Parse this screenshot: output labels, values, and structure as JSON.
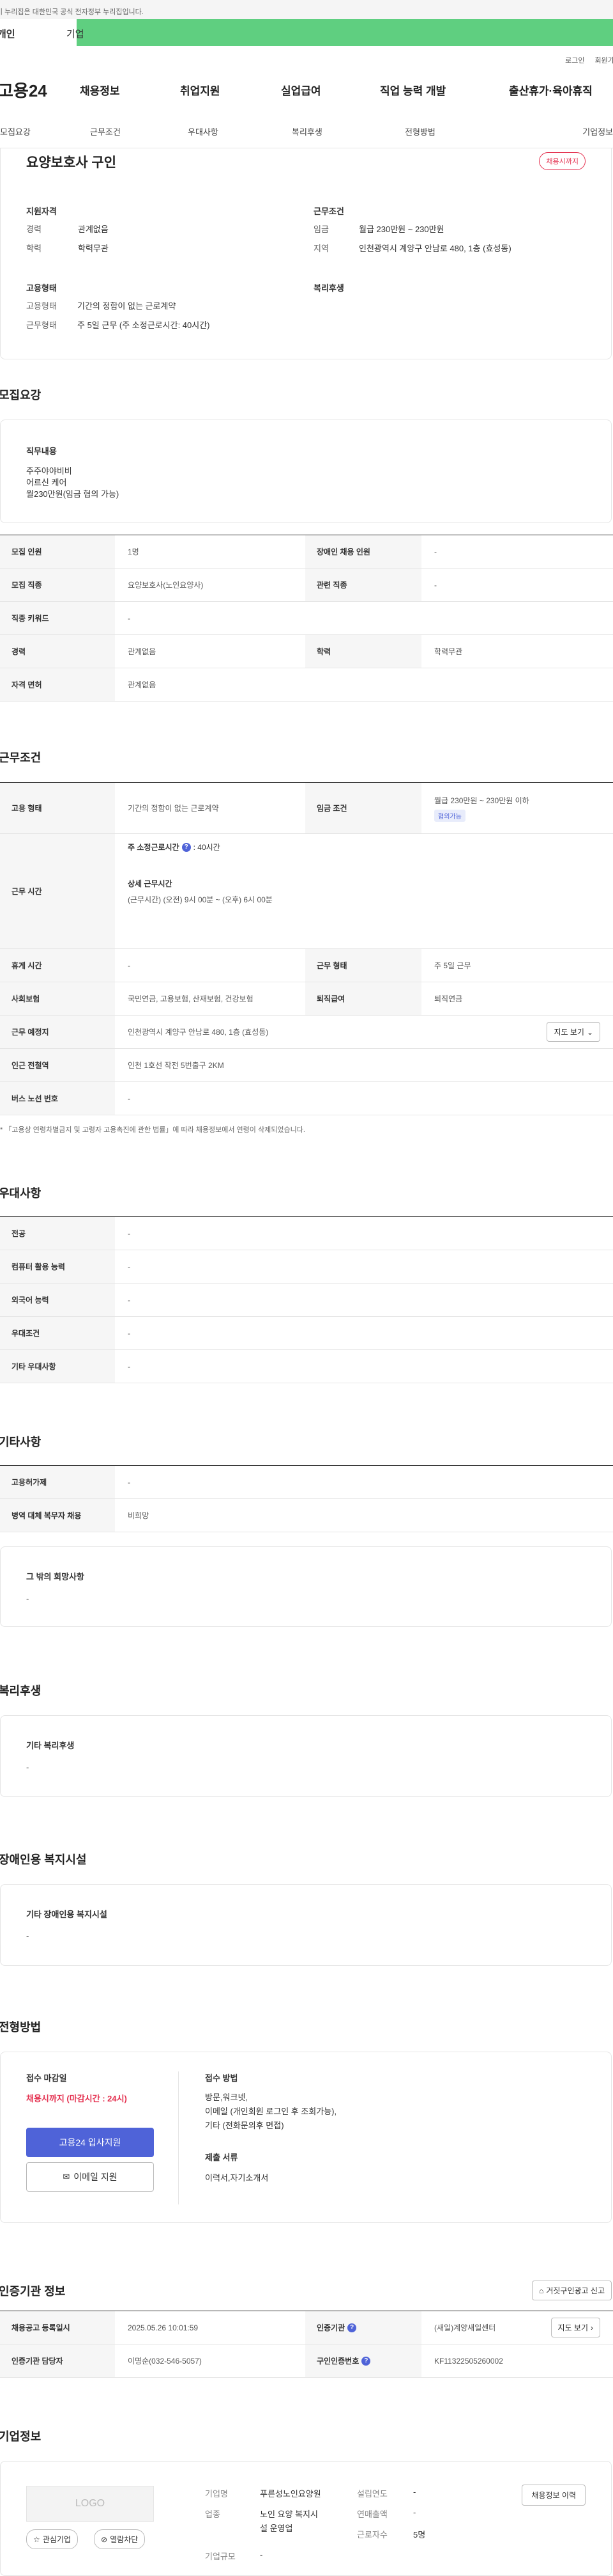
{
  "banner": {
    "text": "이 누리집은 대한민국 공식 전자정부 누리집입니다."
  },
  "top_tabs": {
    "individual": "개인",
    "business": "기업"
  },
  "utility": {
    "login": "로그인",
    "join": "회원가입"
  },
  "gnb": {
    "logo": "고용24",
    "items": [
      "채용정보",
      "취업지원",
      "실업급여",
      "직업 능력 개발",
      "출산휴가·육아휴직"
    ]
  },
  "lnb": {
    "items": [
      "모집요강",
      "근무조건",
      "우대사항",
      "복리후생",
      "전형방법",
      "기업정보"
    ]
  },
  "summary": {
    "title": "요양보호사 구인",
    "status_badge": "채용시까지",
    "qual": {
      "heading": "지원자격",
      "exp_k": "경력",
      "exp_v": "관계없음",
      "edu_k": "학력",
      "edu_v": "학력무관"
    },
    "cond": {
      "heading": "근무조건",
      "wage_k": "임금",
      "wage_v": "월급 230만원 ~ 230만원",
      "area_k": "지역",
      "area_v": "인천광역시 계양구 안남로 480, 1층 (효성동)"
    },
    "emp": {
      "heading": "고용형태",
      "type_k": "고용형태",
      "type_v": "기간의 정함이 없는 근로계약",
      "work_k": "근무형태",
      "work_v": "주 5일 근무 (주 소정근로시간: 40시간)"
    },
    "welfare": {
      "heading": "복리후생"
    }
  },
  "recruit": {
    "heading": "모집요강",
    "duty_heading": "직무내용",
    "duty_lines": [
      "주주야야비비",
      "어르신 케어",
      "월230만원(임금 협의 가능)"
    ],
    "rows": {
      "count_k": "모집 인원",
      "count_v": "1명",
      "disabled_k": "장애인 채용 인원",
      "disabled_v": "-",
      "job_k": "모집 직종",
      "job_v": "요양보호사(노인요양사)",
      "related_k": "관련 직종",
      "related_v": "-",
      "keyword_k": "직종 키워드",
      "keyword_v": "-",
      "career_k": "경력",
      "career_v": "관계없음",
      "edu_k": "학력",
      "edu_v": "학력무관",
      "license_k": "자격 면허",
      "license_v": "관계없음"
    }
  },
  "work": {
    "heading": "근무조건",
    "type_k": "고용 형태",
    "type_v": "기간의 정함이 없는 근로계약",
    "wage_k": "임금 조건",
    "wage_v": "월급 230만원 ~ 230만원 이하",
    "wage_badge": "협의가능",
    "hours_k": "근무 시간",
    "hours_weekly": "주 소정근로시간",
    "hours_weekly_v": ": 40시간",
    "hours_detail_h": "상세 근무시간",
    "hours_detail_v": "(근무시간) (오전) 9시 00분 ~ (오후) 6시 00분",
    "rest_k": "휴게 시간",
    "rest_v": "-",
    "shape_k": "근무 형태",
    "shape_v": "주 5일 근무",
    "ins_k": "사회보험",
    "ins_v": "국민연금, 고용보험, 산재보험, 건강보험",
    "retire_k": "퇴직급여",
    "retire_v": "퇴직연금",
    "place_k": "근무 예정지",
    "place_v": "인천광역시 계양구 안남로 480, 1층 (효성동)",
    "map_btn": "지도 보기",
    "station_k": "인근 전철역",
    "station_v": "인천 1호선 작전 5번출구 2KM",
    "bus_k": "버스 노선 번호",
    "bus_v": "-",
    "note": "* 「고용상 연령차별금지 및 고령자 고용촉진에 관한 법률」에 따라 채용정보에서 연령이 삭제되었습니다."
  },
  "pref": {
    "heading": "우대사항",
    "rows": [
      {
        "k": "전공",
        "v": "-"
      },
      {
        "k": "컴퓨터 활용 능력",
        "v": "-"
      },
      {
        "k": "외국어 능력",
        "v": "-"
      },
      {
        "k": "우대조건",
        "v": "-"
      },
      {
        "k": "기타 우대사항",
        "v": "-"
      }
    ]
  },
  "etc": {
    "heading": "기타사항",
    "rows": [
      {
        "k": "고용허가제",
        "v": "-"
      },
      {
        "k": "병역 대체 복무자 채용",
        "v": "비희망"
      }
    ],
    "hope_h": "그 밖의 희망사항",
    "hope_v": "-"
  },
  "welfare": {
    "heading": "복리후생",
    "etc_h": "기타 복리후생",
    "etc_v": "-"
  },
  "disabled": {
    "heading": "장애인용 복지시설",
    "etc_h": "기타 장애인용 복지시설",
    "etc_v": "-"
  },
  "selection": {
    "heading": "전형방법",
    "deadline_h": "접수 마감일",
    "deadline_v": "채용시까지 (마감시간 : 24시)",
    "apply_btn": "고용24 입사지원",
    "email_btn": "이메일 지원",
    "method_h": "접수 방법",
    "method_lines": [
      "방문,워크넷,",
      "이메일 (개인회원 로그인 후 조회가능),",
      "기타 (전화문의후 면접)"
    ],
    "docs_h": "제출 서류",
    "docs_v": "이력서,자기소개서"
  },
  "agency": {
    "heading": "인증기관 정보",
    "report_btn": "거짓구인광고 신고",
    "reg_k": "채용공고 등록일시",
    "reg_v": "2025.05.26 10:01:59",
    "cert_k": "인증기관",
    "cert_v": "(새일)계양새일센터",
    "map_btn": "지도 보기",
    "mgr_k": "인증기관 담당자",
    "mgr_v": "이명순(032-546-5057)",
    "certno_k": "구인인증번호",
    "certno_v": "KF11322505260002"
  },
  "company": {
    "heading": "기업정보",
    "logo": "LOGO",
    "fav_btn": "관심기업",
    "block_btn": "열람차단",
    "history_btn": "채용정보 이력",
    "name_k": "기업명",
    "name_v": "푸른성노인요양원",
    "year_k": "설립연도",
    "year_v": "-",
    "biz_k": "업종",
    "biz_v1": "노인 요양 복지시",
    "biz_v2": "설 운영업",
    "sales_k": "연매출액",
    "sales_v": "-",
    "staff_k": "근로자수",
    "staff_v": "5명",
    "size_k": "기업규모",
    "size_v": "-"
  },
  "colors": {
    "accent": "#4f63d8",
    "green": "#5fcf80",
    "red": "#e4304f"
  }
}
